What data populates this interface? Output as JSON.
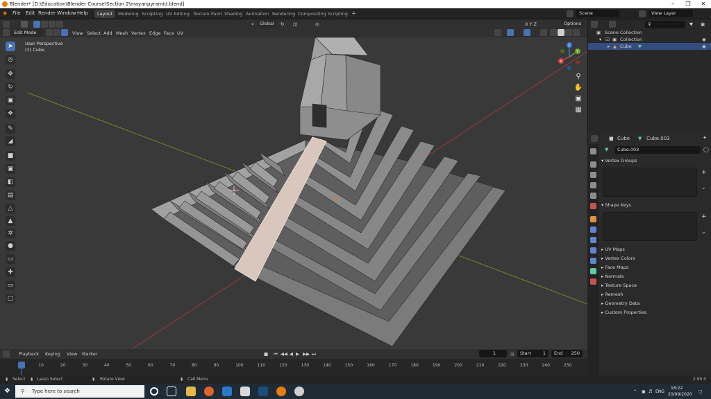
{
  "window": {
    "title": "Blender* [D:\\Education\\Blender Course\\Section 2\\mayanpyramid.blend]"
  },
  "menus": [
    "File",
    "Edit",
    "Render",
    "Window",
    "Help"
  ],
  "workspaces": [
    "Layout",
    "Modeling",
    "Sculpting",
    "UV Editing",
    "Texture Paint",
    "Shading",
    "Animation",
    "Rendering",
    "Compositing",
    "Scripting"
  ],
  "active_workspace": "Layout",
  "scene_field": "Scene",
  "view_layer_field": "View Layer",
  "viewport_header": {
    "mode": "Edit Mode",
    "menus": [
      "View",
      "Select",
      "Add",
      "Mesh",
      "Vertex",
      "Edge",
      "Face",
      "UV"
    ],
    "orientation": "Global",
    "axes": "X Y Z",
    "options": "Options"
  },
  "viewport": {
    "perspective_label": "User Perspective",
    "object_label": "(1) Cube",
    "gizmo_axes": [
      "X",
      "Y",
      "Z"
    ]
  },
  "timeline": {
    "menus": [
      "Playback",
      "Keying",
      "View",
      "Marker"
    ],
    "current_frame": "1",
    "start_label": "Start",
    "start": "1",
    "end_label": "End",
    "end": "250",
    "ticks": [
      "1",
      "10",
      "20",
      "30",
      "40",
      "50",
      "60",
      "70",
      "80",
      "90",
      "100",
      "110",
      "120",
      "130",
      "140",
      "150",
      "160",
      "170",
      "180",
      "190",
      "200",
      "210",
      "220",
      "230",
      "240",
      "250"
    ]
  },
  "statusbar": {
    "select": "Select",
    "lasso": "Lasso Select",
    "rotate": "Rotate View",
    "call_menu": "Call Menu",
    "version": "2.90.0"
  },
  "outliner": {
    "scene_collection": "Scene Collection",
    "collection": "Collection",
    "object": "Cube"
  },
  "properties": {
    "object_name": "Cube",
    "mesh_name": "Cube.003",
    "datablock": "Cube.003",
    "panels_open": [
      "Vertex Groups",
      "Shape Keys"
    ],
    "panels_closed": [
      "UV Maps",
      "Vertex Colors",
      "Face Maps",
      "Normals",
      "Texture Space",
      "Remesh",
      "Geometry Data",
      "Custom Properties"
    ]
  },
  "taskbar": {
    "search_placeholder": "Type here to search",
    "language": "ENG",
    "time": "16:22",
    "date": "20/09/2020"
  },
  "colors": {
    "accent": "#4772b3",
    "viewport_bg": "#393939",
    "mesh_face": "#8a8a8a",
    "selected_face": "#d9c7bd"
  }
}
